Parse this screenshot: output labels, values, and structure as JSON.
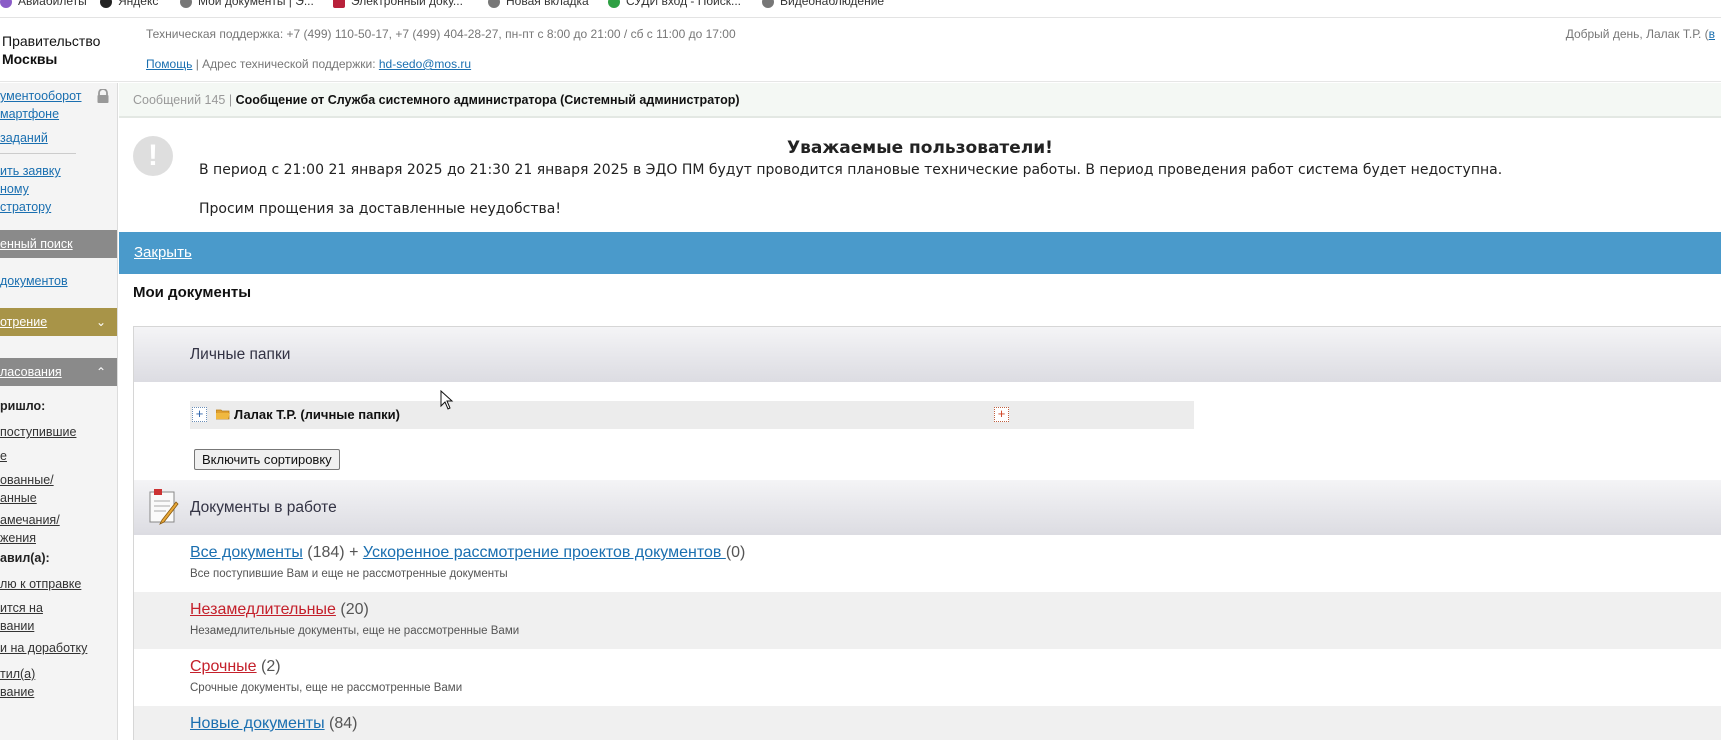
{
  "bookmarks": [
    {
      "label": "Авиабилеты",
      "color": "#8a5cc7"
    },
    {
      "label": "Яндекс",
      "color": "#222222"
    },
    {
      "label": "Мои документы | Э...",
      "color": "#777777"
    },
    {
      "label": "Электронный доку...",
      "color": "#b8213a"
    },
    {
      "label": "Новая вкладка",
      "color": "#777777"
    },
    {
      "label": "СУДИ вход - Поиск...",
      "color": "#2ea043"
    },
    {
      "label": "Видеонаблюдение",
      "color": "#777777"
    }
  ],
  "header": {
    "org_line1": "Правительство",
    "org_line2": "Москвы",
    "support": "Техническая поддержка: +7 (499) 110-50-17, +7 (499) 404-28-27, пн-пт с 8:00 до 21:00 / сб с 11:00 до 17:00",
    "help_link": "Помощь",
    "help_sep": " | Адрес технической поддержки: ",
    "email": "hd-sedo@mos.ru",
    "greeting": "Добрый день, Лалак Т.Р. ("
  },
  "sidebar": {
    "link1": "ументооборот\nмартфоне",
    "link2": "заданий",
    "link3": "ить заявку\nному\nстратору",
    "head_search": "енный поиск",
    "link4": "документов",
    "head_review": "отрение",
    "head_approval": "ласования",
    "label_came": "ришло:",
    "item1": "поступившие",
    "item2": "е",
    "item3": "ованные/\nанные",
    "item4": "амечания/\nжения",
    "label_sent": "авил(а):",
    "item5": "лю к отправке",
    "item6": "ится на\nвании",
    "item7": "и на доработку",
    "item8": "тил(а)\nвание",
    "colors": {
      "search_head": "#8a8a8a",
      "review_head": "#a89448",
      "approval_head": "#8a8a8a"
    }
  },
  "message": {
    "count": "Сообщений 145",
    "title": "Сообщение от Служба системного администратора (Системный администратор)"
  },
  "notice": {
    "title": "Уважаемые пользователи!",
    "line1": "В период с 21:00 21 января 2025 до 21:30 21 января 2025 в ЭДО ПМ будут проводится плановые технические работы. В период проведения работ система будет недоступна.",
    "line2": "Просим прощения за доставленные неудобства!",
    "close": "Закрыть",
    "bar_color": "#4a9acb"
  },
  "main": {
    "title": "Мои документы",
    "personal": {
      "heading": "Личные папки",
      "folder": "Лалак Т.Р. (личные папки)",
      "sort_button": "Включить сортировку"
    },
    "inwork": {
      "heading": "Документы в работе",
      "rows": [
        {
          "link": "Все документы",
          "count": "(184)",
          "plus": " + ",
          "link2": "Ускоренное рассмотрение проектов документов ",
          "count2": "(0)",
          "desc": "Все поступившие Вам и еще не рассмотренные документы"
        },
        {
          "link": "Незамедлительные",
          "count": "(20)",
          "desc": "Незамедлительные документы, еще не рассмотренные Вами"
        },
        {
          "link": "Срочные",
          "count": "(2)",
          "desc": "Срочные документы, еще не рассмотренные Вами"
        },
        {
          "link": "Новые документы",
          "count": "(84)",
          "desc": ""
        }
      ]
    }
  }
}
